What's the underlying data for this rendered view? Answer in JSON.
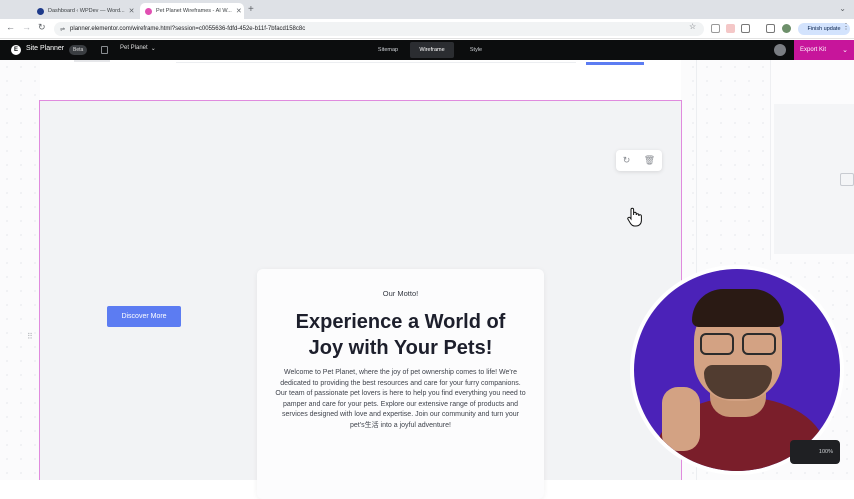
{
  "browser": {
    "tabs": [
      {
        "title": "Dashboard ‹ WPDev — Word...",
        "active": false,
        "favicon_color": "#1e3a8a"
      },
      {
        "title": "Pet Planet Wireframes - AI W...",
        "active": true,
        "favicon_color": "#e14fb2"
      }
    ],
    "url": "planner.elementor.com/wireframe.html?session=c0055636-fdfd-452e-b11f-7bfacd158c8c",
    "finish_update_label": "Finish update",
    "icons": {
      "back": "back-arrow-icon",
      "forward": "forward-arrow-icon",
      "reload": "reload-icon",
      "star": "bookmark-star-icon",
      "menu": "kebab-menu-icon"
    }
  },
  "app": {
    "title": "Site Planner",
    "badge": "Beta",
    "project_name": "Pet Planet",
    "tabs": [
      {
        "label": "Sitemap",
        "active": false
      },
      {
        "label": "Wireframe",
        "active": true
      },
      {
        "label": "Style",
        "active": false
      }
    ],
    "export_label": "Export Kit",
    "colors": {
      "header_bg": "#0c0d0e",
      "export_bg": "#c7159b",
      "accent": "#5c7cf2",
      "selection": "#e08bde"
    }
  },
  "hero": {
    "eyebrow": "Our Motto!",
    "headline_line1": "Experience a World of",
    "headline_line2": "Joy with Your Pets!",
    "body": "Welcome to Pet Planet, where the joy of pet ownership comes to life! We're dedicated to providing the best resources and care for your furry companions. Our team of passionate pet lovers is here to help you find everything you need to pamper and care for your pets. Explore our extensive range of products and services designed with love and expertise. Join our community and turn your pet's生活 into a joyful adventure!",
    "cta_label": "Discover More",
    "toolbar_icons": [
      "refresh-icon",
      "trash-icon"
    ]
  },
  "zoom_label": "100%"
}
